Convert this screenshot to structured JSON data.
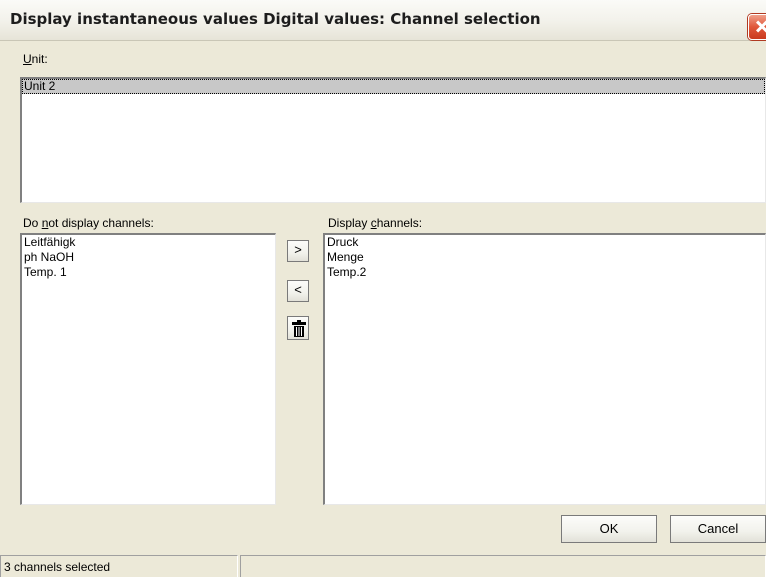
{
  "window": {
    "title": "Display instantaneous values Digital values: Channel selection"
  },
  "unit_section": {
    "label_accel": "U",
    "label_rest": "nit:",
    "items": [
      "Unit 2"
    ],
    "selected_index": 0
  },
  "hidden_channels": {
    "label_pre": "Do ",
    "label_accel": "n",
    "label_post": "ot display channels:",
    "items": [
      "Leitfähigk",
      "ph NaOH",
      "Temp. 1"
    ]
  },
  "shown_channels": {
    "label_pre": "Display ",
    "label_accel": "c",
    "label_post": "hannels:",
    "items": [
      "Druck",
      "Menge",
      "Temp.2"
    ]
  },
  "transfer_buttons": {
    "add_label": ">",
    "remove_label": "<",
    "delete_icon": "trash-icon"
  },
  "dialog_buttons": {
    "ok_label": "OK",
    "cancel_label": "Cancel"
  },
  "status": {
    "text": "3 channels selected",
    "second_pane": ""
  }
}
